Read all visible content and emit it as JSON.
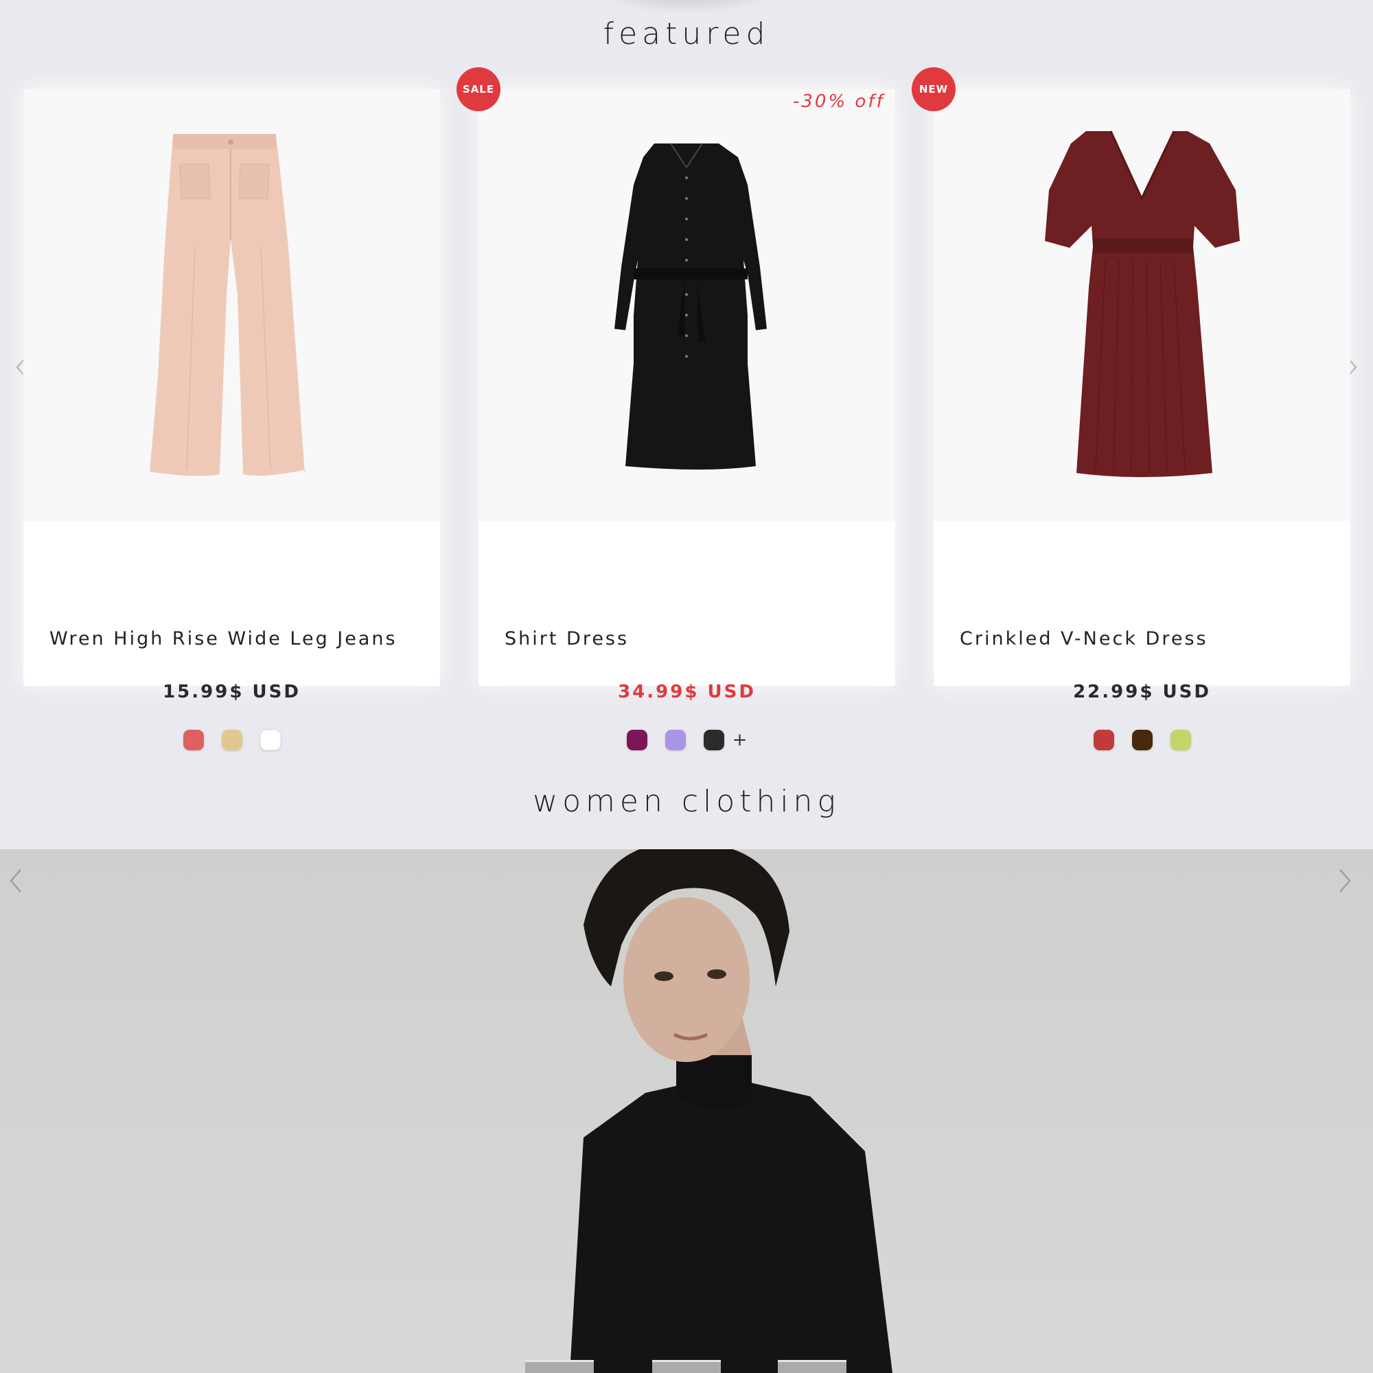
{
  "featured": {
    "title": "featured",
    "products": [
      {
        "name": "Wren High Rise Wide Leg Jeans",
        "price": "15.99$ USD",
        "on_sale": false,
        "badge": "",
        "discount": "",
        "swatches": [
          "#de6060",
          "#e2c890",
          "#ffffff"
        ],
        "more_colors": ""
      },
      {
        "name": "Shirt Dress",
        "price": "34.99$ USD",
        "on_sale": true,
        "badge": "SALE",
        "discount": "-30% off",
        "swatches": [
          "#7b1659",
          "#a994e6",
          "#2b2b2b"
        ],
        "more_colors": "+"
      },
      {
        "name": "Crinkled V-Neck Dress",
        "price": "22.99$ USD",
        "on_sale": false,
        "badge": "NEW",
        "discount": "",
        "swatches": [
          "#c23a3a",
          "#4a2a0c",
          "#c2d56a"
        ],
        "more_colors": ""
      }
    ]
  },
  "women": {
    "title": "women clothing"
  },
  "colors": {
    "accent": "#e03a3e",
    "background": "#e9e9ef"
  },
  "icons": {
    "prev": "chevron-left-icon",
    "next": "chevron-right-icon"
  }
}
